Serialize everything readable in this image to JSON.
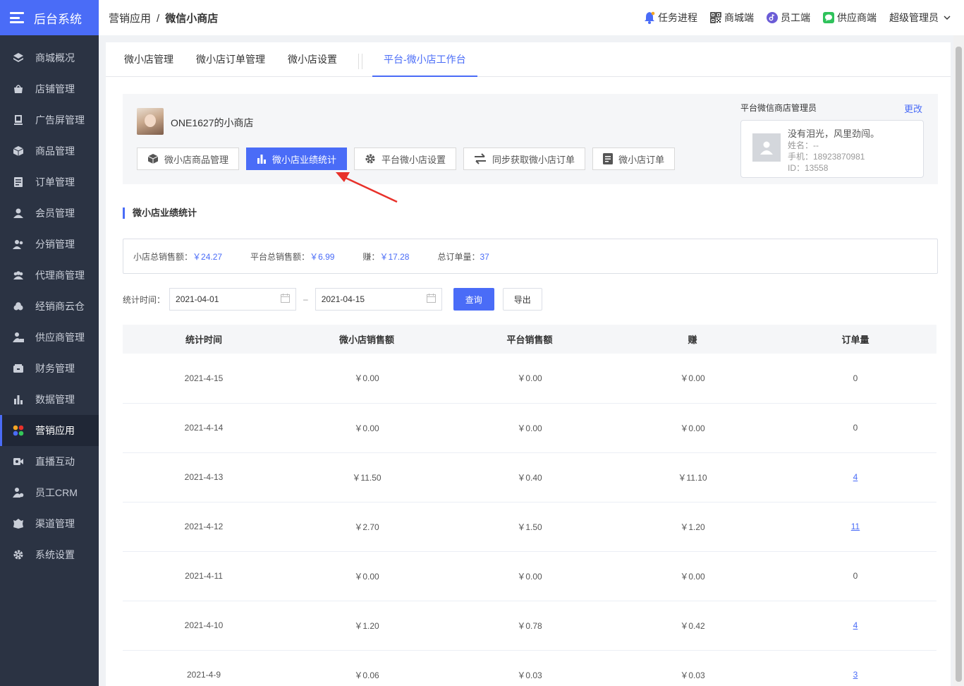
{
  "brand": {
    "title": "后台系统"
  },
  "sidebar": {
    "items": [
      {
        "label": "商城概况",
        "icon": "layers-icon"
      },
      {
        "label": "店铺管理",
        "icon": "shop-icon"
      },
      {
        "label": "广告屏管理",
        "icon": "screen-icon"
      },
      {
        "label": "商品管理",
        "icon": "box-icon"
      },
      {
        "label": "订单管理",
        "icon": "order-icon"
      },
      {
        "label": "会员管理",
        "icon": "user-icon"
      },
      {
        "label": "分销管理",
        "icon": "users-icon"
      },
      {
        "label": "代理商管理",
        "icon": "group-icon"
      },
      {
        "label": "经销商云仓",
        "icon": "cloud-icon"
      },
      {
        "label": "供应商管理",
        "icon": "supplier-icon"
      },
      {
        "label": "财务管理",
        "icon": "wallet-icon"
      },
      {
        "label": "数据管理",
        "icon": "bar-chart-icon"
      },
      {
        "label": "营销应用",
        "icon": "apps-icon",
        "active": true
      },
      {
        "label": "直播互动",
        "icon": "video-icon"
      },
      {
        "label": "员工CRM",
        "icon": "crm-icon"
      },
      {
        "label": "渠道管理",
        "icon": "channel-icon"
      },
      {
        "label": "系统设置",
        "icon": "gear-icon"
      }
    ]
  },
  "header": {
    "breadcrumb": [
      "营销应用",
      "微信小商店"
    ],
    "links": [
      "任务进程",
      "商城端",
      "员工端",
      "供应商端"
    ],
    "user": "超级管理员"
  },
  "tabs": [
    "微小店管理",
    "微小店订单管理",
    "微小店设置",
    "平台-微小店工作台"
  ],
  "shop": {
    "name": "ONE1627的小商店",
    "buttons": [
      "微小店商品管理",
      "微小店业绩统计",
      "平台微小店设置",
      "同步获取微小店订单",
      "微小店订单"
    ]
  },
  "admin": {
    "title": "平台微信商店管理员",
    "change": "更改",
    "motto": "没有泪光，风里劲闯。",
    "name_line": "姓名：--",
    "phone_line": "手机：18923870981",
    "id_line": "ID：13558"
  },
  "section": {
    "title": "微小店业绩统计"
  },
  "summary": {
    "shop_total_label": "小店总销售额：",
    "shop_total": "￥24.27",
    "platform_total_label": "平台总销售额：",
    "platform_total": "￥6.99",
    "earn_label": "赚：",
    "earn": "￥17.28",
    "orders_label": "总订单量：",
    "orders": "37"
  },
  "filter": {
    "label": "统计时间：",
    "start": "2021-04-01",
    "end": "2021-04-15",
    "dash": "–",
    "query": "查询",
    "export": "导出"
  },
  "table": {
    "headers": [
      "统计时间",
      "微小店销售额",
      "平台销售额",
      "赚",
      "订单量"
    ],
    "rows": [
      [
        "2021-4-15",
        "￥0.00",
        "￥0.00",
        "￥0.00",
        "0"
      ],
      [
        "2021-4-14",
        "￥0.00",
        "￥0.00",
        "￥0.00",
        "0"
      ],
      [
        "2021-4-13",
        "￥11.50",
        "￥0.40",
        "￥11.10",
        "4"
      ],
      [
        "2021-4-12",
        "￥2.70",
        "￥1.50",
        "￥1.20",
        "11"
      ],
      [
        "2021-4-11",
        "￥0.00",
        "￥0.00",
        "￥0.00",
        "0"
      ],
      [
        "2021-4-10",
        "￥1.20",
        "￥0.78",
        "￥0.42",
        "4"
      ],
      [
        "2021-4-9",
        "￥0.06",
        "￥0.03",
        "￥0.03",
        "3"
      ]
    ]
  },
  "colors": {
    "accent": "#4a6cf7",
    "sidebar": "#2b3343",
    "arrow": "#e8312a"
  }
}
